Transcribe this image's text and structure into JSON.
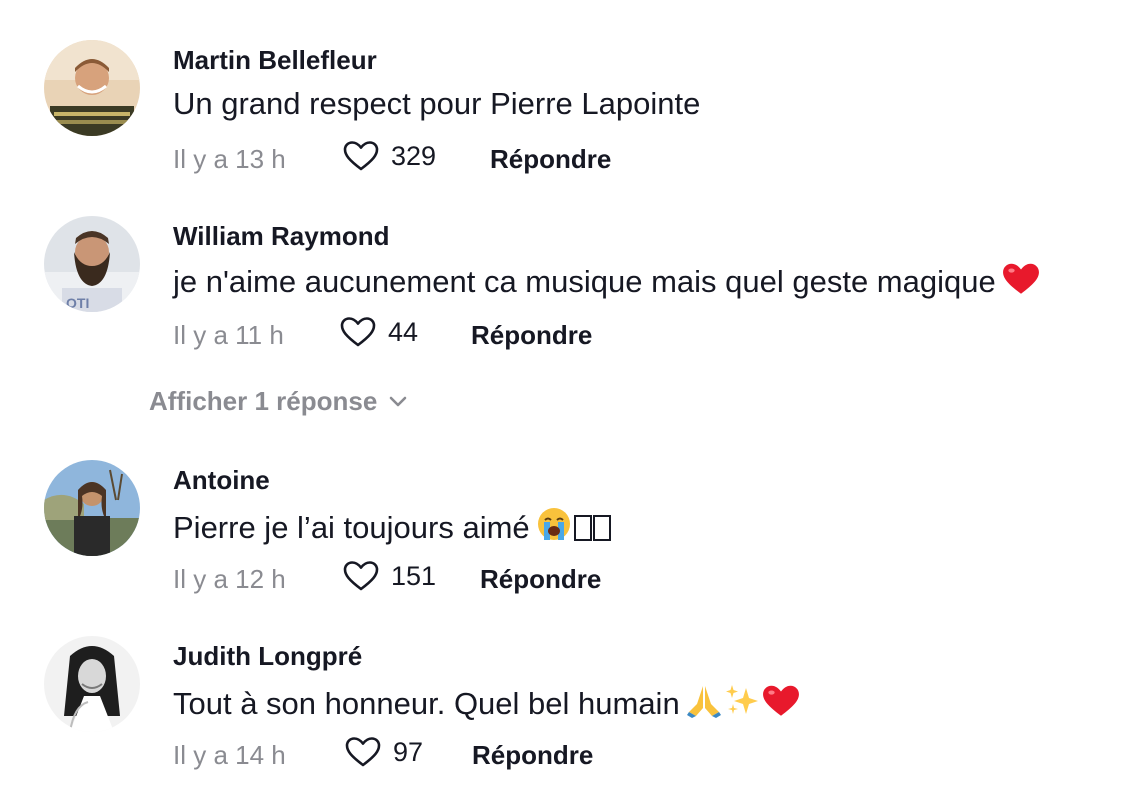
{
  "comments": [
    {
      "username": "Martin Bellefleur",
      "text": "Un grand respect pour Pierre Lapointe",
      "time": "Il y a 13 h",
      "likes": "329",
      "reply_label": "Répondre",
      "avatar": "man-smiling-photo"
    },
    {
      "username": "William Raymond",
      "text": "je n'aime aucunement ca musique mais quel geste magique",
      "emojis": [
        "red-heart-emoji"
      ],
      "time": "Il y a 11 h",
      "likes": "44",
      "reply_label": "Répondre",
      "avatar": "bearded-man-photo"
    },
    {
      "username": "Antoine",
      "text": "Pierre je l’ai toujours aimé",
      "emojis": [
        "loudly-crying-face-emoji",
        "missing-glyph-box",
        "missing-glyph-box"
      ],
      "time": "Il y a 12 h",
      "likes": "151",
      "reply_label": "Répondre",
      "avatar": "long-hair-person-photo"
    },
    {
      "username": "Judith Longpré",
      "text": "Tout à son honneur. Quel bel humain",
      "emojis": [
        "folded-hands-emoji",
        "sparkles-emoji",
        "red-heart-emoji"
      ],
      "time": "Il y a 14 h",
      "likes": "97",
      "reply_label": "Répondre",
      "avatar": "woman-black-white-photo"
    }
  ],
  "view_replies": {
    "label": "Afficher 1 réponse",
    "icon": "chevron-down-icon"
  },
  "colors": {
    "text": "#161823",
    "muted": "#8a8b91",
    "heart": "#e8192c"
  }
}
